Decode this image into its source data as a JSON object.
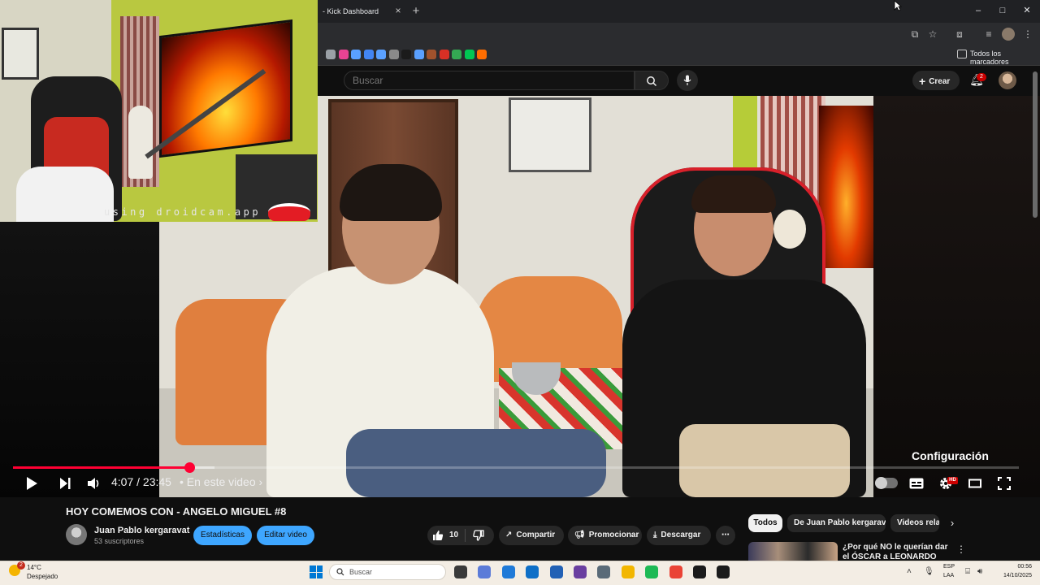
{
  "webcam": {
    "watermark": "using droidcam.app"
  },
  "browser": {
    "tab_title": "- Kick Dashboard",
    "tab_close": "×",
    "new_tab": "+",
    "window_controls": {
      "minimize": "–",
      "maximize": "□",
      "close": "✕"
    },
    "bookmarks_all_label": "Todos los marcadores",
    "toolbar_icons": [
      "cast-icon",
      "star-icon",
      "extensions-icon",
      "media-icon",
      "profile-icon",
      "menu-icon"
    ],
    "bookmark_colors": [
      "#9aa0a6",
      "#e84393",
      "#5aa0ff",
      "#4285f4",
      "#5aa0ff",
      "#8a8a8a",
      "#1b1b1b",
      "#5aa0ff",
      "#a0522d",
      "#d93025",
      "#34a853",
      "#00c853",
      "#ff6d00"
    ]
  },
  "youtube": {
    "search_placeholder": "Buscar",
    "create_label": "Crear",
    "notif_count": "2"
  },
  "player": {
    "progress_fraction": 0.175,
    "buffer_fraction": 0.2,
    "current_time": "4:07",
    "duration": "23:45",
    "time_display": "4:07 / 23:45",
    "chapter_label": "• En este video ›",
    "tooltip": "Configuración",
    "hd_badge": "HD"
  },
  "video": {
    "title": "HOY COMEMOS CON - ANGELO MIGUEL #8",
    "channel": "Juan Pablo kergaravat",
    "subscribers": "53 suscriptores",
    "actions": {
      "stats": "Estadísticas",
      "edit": "Editar video",
      "likes": "10",
      "share": "Compartir",
      "promote": "Promocionar",
      "download": "Descargar",
      "more": "⋯"
    }
  },
  "sidebar": {
    "chips": [
      "Todos",
      "De Juan Pablo kergaravat",
      "Videos relacionados"
    ],
    "rec_title": "¿Por qué NO le querían dar el ÓSCAR a LEONARDO",
    "rec_more": "⋮"
  },
  "taskbar": {
    "weather_badge": "2",
    "temperature": "14°C",
    "weather": "Despejado",
    "search_label": "Buscar",
    "lang1": "ESP",
    "lang2": "LAA",
    "time": "00:56",
    "date": "14/10/2025",
    "app_colors": [
      "#3a3a3a",
      "#5b7bd8",
      "#1f7ad8",
      "#0e6fc7",
      "#2261b5",
      "#6a3fa0",
      "#5a6b78",
      "#f2b600",
      "#1db954",
      "#ea4335",
      "#1b1b1b",
      "#1b1b1b"
    ]
  }
}
